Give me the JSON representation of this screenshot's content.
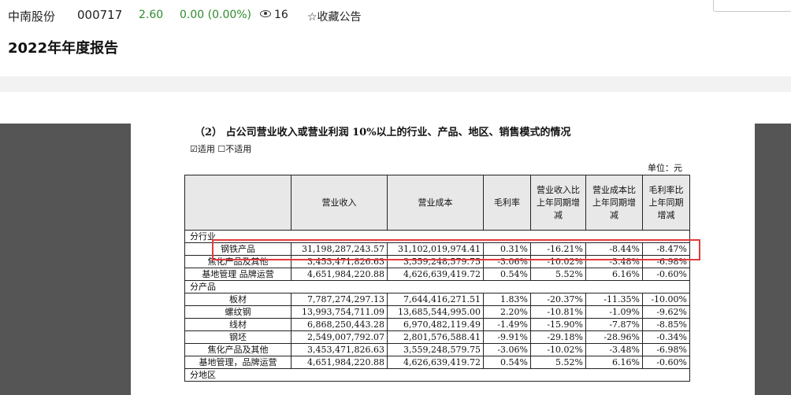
{
  "header": {
    "stock_name": "中南股份",
    "stock_code": "000717",
    "price": "2.60",
    "change": "0.00 (0.00%)",
    "view_count": "16",
    "favorite_label": "☆收藏公告",
    "colors": {
      "quote": "#2e8b2e",
      "highlight": "#e23b3b"
    }
  },
  "report_title": "2022年年度报告",
  "document": {
    "heading": "（2） 占公司营业收入或营业利润 10%以上的行业、产品、地区、销售模式的情况",
    "applicable": "☑适用 ☐不适用",
    "unit": "单位：元",
    "columns": [
      "",
      "营业收入",
      "营业成本",
      "毛利率",
      "营业收入比上年同期增减",
      "营业成本比上年同期增减",
      "毛利率比上年同期增减"
    ],
    "sections": {
      "industry": "分行业",
      "product": "分产品",
      "region": "分地区"
    },
    "industry_rows": [
      [
        "钢铁产品",
        "31,198,287,243.57",
        "31,102,019,974.41",
        "0.31%",
        "-16.21%",
        "-8.44%",
        "-8.47%"
      ],
      [
        "焦化产品及其他",
        "3,453,471,826.63",
        "3,559,248,579.75",
        "-3.06%",
        "-10.02%",
        "-3.48%",
        "-6.98%"
      ],
      [
        "基地管理 品牌运营",
        "4,651,984,220.88",
        "4,626,639,419.72",
        "0.54%",
        "5.52%",
        "6.16%",
        "-0.60%"
      ]
    ],
    "product_rows": [
      [
        "板材",
        "7,787,274,297.13",
        "7,644,416,271.51",
        "1.83%",
        "-20.37%",
        "-11.35%",
        "-10.00%"
      ],
      [
        "螺纹钢",
        "13,993,754,711.09",
        "13,685,544,995.00",
        "2.20%",
        "-10.81%",
        "-1.09%",
        "-9.62%"
      ],
      [
        "线材",
        "6,868,250,443.28",
        "6,970,482,119.49",
        "-1.49%",
        "-15.90%",
        "-7.87%",
        "-8.85%"
      ],
      [
        "钢坯",
        "2,549,007,792.07",
        "2,801,576,588.41",
        "-9.91%",
        "-29.18%",
        "-28.96%",
        "-0.34%"
      ],
      [
        "焦化产品及其他",
        "3,453,471,826.63",
        "3,559,248,579.75",
        "-3.06%",
        "-10.02%",
        "-3.48%",
        "-6.98%"
      ],
      [
        "基地管理，品牌运营",
        "4,651,984,220.88",
        "4,626,639,419.72",
        "0.54%",
        "5.52%",
        "6.16%",
        "-0.60%"
      ]
    ]
  }
}
